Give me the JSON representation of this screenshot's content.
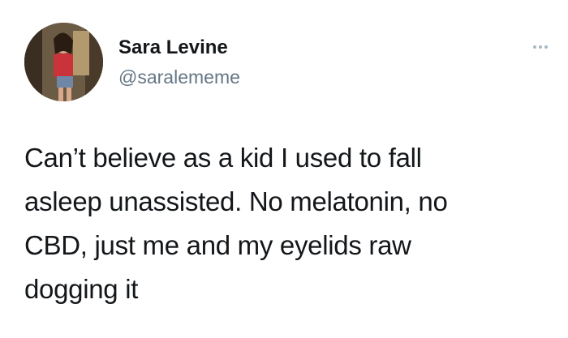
{
  "user": {
    "display_name": "Sara Levine",
    "handle": "@saralememe",
    "avatar_icon": "profile-photo"
  },
  "more_icon": "more-horizontal-icon",
  "tweet": {
    "lines": [
      "Can’t believe as a kid I used to fall",
      "asleep unassisted. No melatonin, no",
      "CBD, just me and my eyelids raw",
      "dogging it"
    ]
  },
  "colors": {
    "text": "#14171a",
    "secondary": "#657786",
    "background": "#ffffff"
  }
}
